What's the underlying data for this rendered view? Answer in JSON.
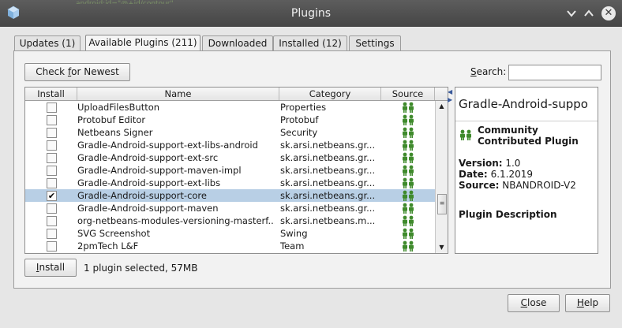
{
  "window": {
    "title": "Plugins"
  },
  "background_code": "android:id=\"@+id/contour\"",
  "tabs": [
    {
      "label": "Updates (1)",
      "active": false
    },
    {
      "label": "Available Plugins (211)",
      "active": true
    },
    {
      "label": "Downloaded",
      "active": false
    },
    {
      "label": "Installed (12)",
      "active": false
    },
    {
      "label": "Settings",
      "active": false
    }
  ],
  "toolbar": {
    "check_newest_label": "Check for Newest",
    "check_newest_mnemonic": "f"
  },
  "search": {
    "label": "Search:",
    "value": ""
  },
  "table": {
    "columns": [
      "Install",
      "Name",
      "Category",
      "Source"
    ],
    "rows": [
      {
        "checked": false,
        "name": "UploadFilesButton",
        "category": "Properties",
        "source_icon": "community-icon",
        "selected": false
      },
      {
        "checked": false,
        "name": "Protobuf Editor",
        "category": "Protobuf",
        "source_icon": "community-icon",
        "selected": false
      },
      {
        "checked": false,
        "name": "Netbeans Signer",
        "category": "Security",
        "source_icon": "community-icon",
        "selected": false
      },
      {
        "checked": false,
        "name": "Gradle-Android-support-ext-libs-android",
        "category": "sk.arsi.netbeans.gr...",
        "source_icon": "community-icon",
        "selected": false
      },
      {
        "checked": false,
        "name": "Gradle-Android-support-ext-src",
        "category": "sk.arsi.netbeans.gr...",
        "source_icon": "community-icon",
        "selected": false
      },
      {
        "checked": false,
        "name": "Gradle-Android-support-maven-impl",
        "category": "sk.arsi.netbeans.gr...",
        "source_icon": "community-icon",
        "selected": false
      },
      {
        "checked": false,
        "name": "Gradle-Android-support-ext-libs",
        "category": "sk.arsi.netbeans.gr...",
        "source_icon": "community-icon",
        "selected": false
      },
      {
        "checked": true,
        "name": "Gradle-Android-support-core",
        "category": "sk.arsi.netbeans.gr...",
        "source_icon": "community-icon",
        "selected": true
      },
      {
        "checked": false,
        "name": "Gradle-Android-support-maven",
        "category": "sk.arsi.netbeans.gr...",
        "source_icon": "community-icon",
        "selected": false
      },
      {
        "checked": false,
        "name": "org-netbeans-modules-versioning-masterf...",
        "category": "sk.arsi.netbeans.m...",
        "source_icon": "community-icon",
        "selected": false
      },
      {
        "checked": false,
        "name": "SVG Screenshot",
        "category": "Swing",
        "source_icon": "community-icon",
        "selected": false
      },
      {
        "checked": false,
        "name": "2pmTech L&F",
        "category": "Team",
        "source_icon": "community-icon",
        "selected": false
      }
    ]
  },
  "details": {
    "title": "Gradle-Android-suppo",
    "community_line1": "Community",
    "community_line2": "Contributed Plugin",
    "version_label": "Version:",
    "version": "1.0",
    "date_label": "Date:",
    "date": "6.1.2019",
    "source_label": "Source:",
    "source": "NBANDROID-V2",
    "description_heading": "Plugin Description"
  },
  "footer": {
    "install_label": "Install",
    "install_mnemonic": "I",
    "status": "1 plugin selected, 57MB",
    "close_label": "Close",
    "close_mnemonic": "C",
    "help_label": "Help",
    "help_mnemonic": "H"
  },
  "colors": {
    "selection": "#b8cfe5",
    "title_bar": "#4e4e4e",
    "community_icon": "#3f8a2c"
  }
}
